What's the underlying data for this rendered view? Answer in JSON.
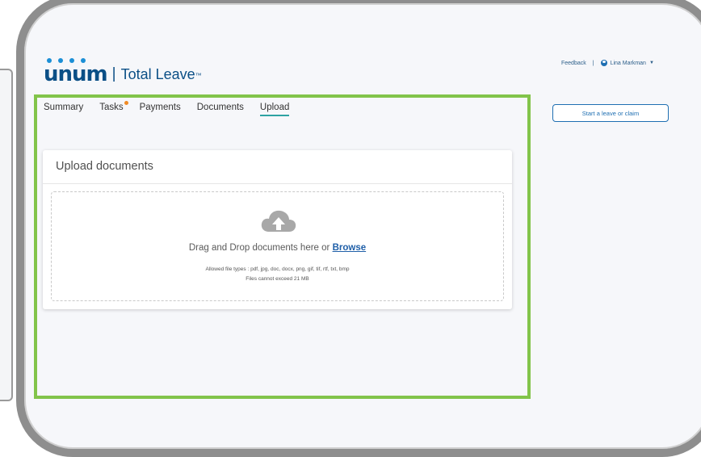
{
  "brand": {
    "logo_word": "unum",
    "separator": "|",
    "product": "Total Leave",
    "trademark": "™"
  },
  "topbar": {
    "feedback": "Feedback",
    "separator": "|",
    "user_name": "Lina Markman",
    "user_icon": "user-circle-icon",
    "caret": "▼"
  },
  "start_button": {
    "label": "Start a leave or claim"
  },
  "tabs": [
    {
      "label": "Summary",
      "active": false
    },
    {
      "label": "Tasks",
      "active": false,
      "notification": true
    },
    {
      "label": "Payments",
      "active": false
    },
    {
      "label": "Documents",
      "active": false
    },
    {
      "label": "Upload",
      "active": true
    }
  ],
  "upload": {
    "title": "Upload documents",
    "icon": "cloud-upload-icon",
    "drop_text": "Drag and Drop documents here or",
    "browse": "Browse",
    "allowed_types": "Allowed file types : pdf, jpg, doc, docx, png, gif, tif, rtf, txt, bmp",
    "size_limit": "Files cannot exceed 21 MB"
  },
  "colors": {
    "brand_blue": "#0b4f86",
    "accent_teal": "#2ea3a3",
    "highlight_green": "#82c44a",
    "notification_orange": "#f08a24",
    "link_blue": "#1f5fa8"
  }
}
